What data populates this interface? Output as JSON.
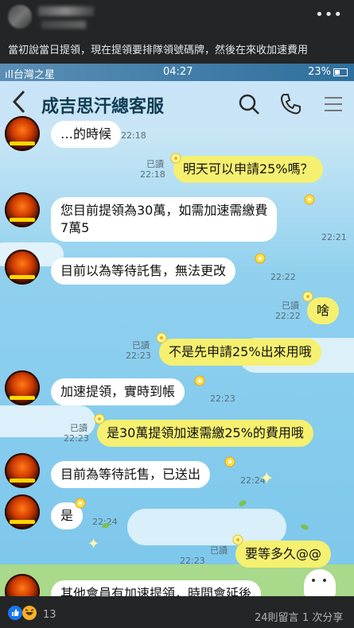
{
  "post": {
    "more_icon": "more-dots-icon",
    "text": "當初說當日提領，現在提領要排隊領號碼牌，然後在來收加速費用"
  },
  "status_bar": {
    "carrier": "ıll台灣之星",
    "time": "04:27",
    "battery": "23%"
  },
  "chat": {
    "title": "成吉思汗總客服",
    "back_icon": "back-chevron-icon",
    "search_icon": "search-icon",
    "call_icon": "phone-icon",
    "menu_icon": "menu-icon",
    "read_label": "已讀",
    "messages": [
      {
        "side": "in",
        "text": "…的時候",
        "time": "22:18"
      },
      {
        "side": "out",
        "text": "明天可以申請25%嗎？",
        "time": "22:18"
      },
      {
        "side": "in",
        "text": "您目前提領為30萬，如需加速需繳費\n7萬5",
        "time": "22:21"
      },
      {
        "side": "in",
        "text": "目前以為等待託售，無法更改",
        "time": "22:22"
      },
      {
        "side": "out",
        "text": "啥",
        "time": "22:22"
      },
      {
        "side": "out",
        "text": "不是先申請25%出來用哦",
        "time": "22:23"
      },
      {
        "side": "in",
        "text": "加速提領，實時到帳",
        "time": "22:23"
      },
      {
        "side": "out",
        "text": "是30萬提領加速需繳25%的費用哦",
        "time": "22:23"
      },
      {
        "side": "in",
        "text": "目前為等待託售，已送出",
        "time": "22:24"
      },
      {
        "side": "in",
        "text": "是",
        "time": "22:24"
      },
      {
        "side": "out",
        "text": "要等多久@@",
        "time": "22:23"
      },
      {
        "side": "in",
        "text": "其他會員有加速提領，時間會延後",
        "time": ""
      }
    ]
  },
  "footer": {
    "reaction_count": "13",
    "comments": "24則留言",
    "shares": "1 次分享"
  }
}
